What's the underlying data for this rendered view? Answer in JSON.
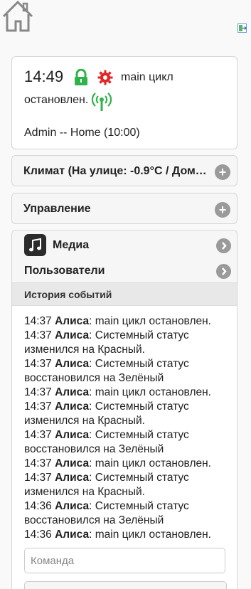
{
  "header": {
    "home_icon": "home-icon",
    "exit_icon": "exit-icon"
  },
  "status": {
    "time": "14:49",
    "lock_icon": "lock-icon",
    "gear_icon": "gear-icon",
    "text_part1": "main цикл",
    "text_part2": "остановлен.",
    "signal_icon": "signal-icon",
    "user_line": "Admin -- Home (10:00)"
  },
  "sections": {
    "climate": "Климат (На улице: -0.9°C / Дома: …",
    "control": "Управление",
    "expand_symbol": "+"
  },
  "menu": {
    "media": "Медиа",
    "users": "Пользователи",
    "history_header": "История событий"
  },
  "events": [
    {
      "time": "14:37",
      "user": "Алиса",
      "text": ": main цикл остановлен."
    },
    {
      "time": "14:37",
      "user": "Алиса",
      "text": ": Системный статус изменился на Красный."
    },
    {
      "time": "14:37",
      "user": "Алиса",
      "text": ": Системный статус восстановился на Зелёный"
    },
    {
      "time": "14:37",
      "user": "Алиса",
      "text": ": main цикл остановлен."
    },
    {
      "time": "14:37",
      "user": "Алиса",
      "text": ": Системный статус изменился на Красный."
    },
    {
      "time": "14:37",
      "user": "Алиса",
      "text": ": Системный статус восстановился на Зелёный"
    },
    {
      "time": "14:37",
      "user": "Алиса",
      "text": ": main цикл остановлен."
    },
    {
      "time": "14:37",
      "user": "Алиса",
      "text": ": Системный статус изменился на Красный."
    },
    {
      "time": "14:36",
      "user": "Алиса",
      "text": ": Системный статус восстановился на Зелёный"
    },
    {
      "time": "14:36",
      "user": "Алиса",
      "text": ": main цикл остановлен."
    }
  ],
  "command": {
    "placeholder": "Команда",
    "value": ""
  }
}
